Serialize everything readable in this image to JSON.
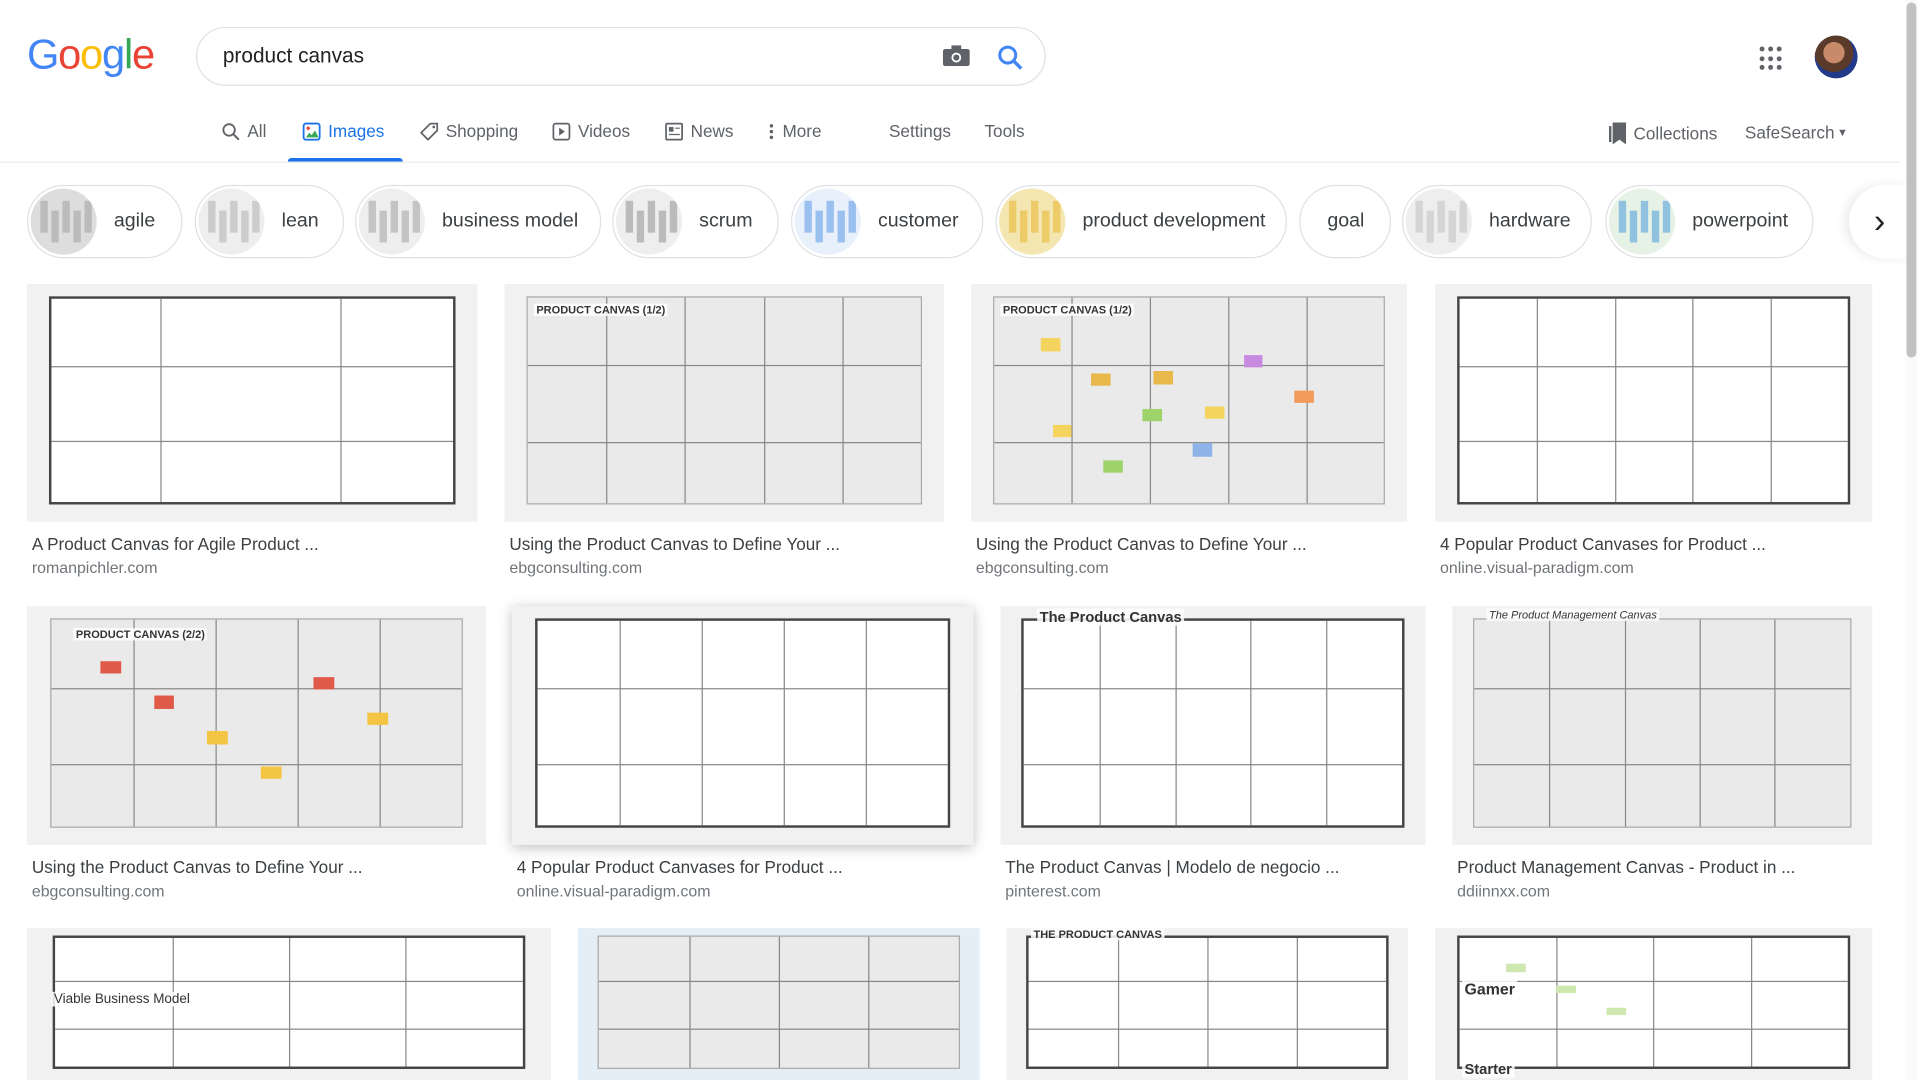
{
  "logo": {
    "letters": [
      "G",
      "o",
      "o",
      "g",
      "l",
      "e"
    ],
    "colors": [
      "#4285f4",
      "#ea4335",
      "#fbbc05",
      "#4285f4",
      "#34a853",
      "#ea4335"
    ]
  },
  "search": {
    "query": "product canvas"
  },
  "tabs": [
    {
      "label": "All",
      "icon": "search-icon"
    },
    {
      "label": "Images",
      "icon": "image-icon",
      "active": true
    },
    {
      "label": "Shopping",
      "icon": "tag-icon"
    },
    {
      "label": "Videos",
      "icon": "play-icon"
    },
    {
      "label": "News",
      "icon": "news-icon"
    },
    {
      "label": "More",
      "icon": "more-vert-icon"
    },
    {
      "label": "Settings"
    },
    {
      "label": "Tools"
    }
  ],
  "right_tools": {
    "collections": "Collections",
    "safesearch": "SafeSearch"
  },
  "chips": [
    "agile",
    "lean",
    "business model",
    "scrum",
    "customer",
    "product development",
    "goal",
    "hardware",
    "powerpoint"
  ],
  "results": [
    {
      "title": "A Product Canvas for Agile Product ...",
      "source": "romanpichler.com"
    },
    {
      "title": "Using the Product Canvas to Define Your ...",
      "source": "ebgconsulting.com"
    },
    {
      "title": "Using the Product Canvas to Define Your ...",
      "source": "ebgconsulting.com"
    },
    {
      "title": "4 Popular Product Canvases for Product ...",
      "source": "online.visual-paradigm.com"
    },
    {
      "title": "Using the Product Canvas to Define Your ...",
      "source": "ebgconsulting.com"
    },
    {
      "title": "4 Popular Product Canvases for Product ...",
      "source": "online.visual-paradigm.com"
    },
    {
      "title": "The Product Canvas | Modelo de negocio ...",
      "source": "pinterest.com"
    },
    {
      "title": "Product Management Canvas - Product in ...",
      "source": "ddiinnxx.com"
    }
  ],
  "thumb_text": {
    "r1c2": "PRODUCT CANVAS (1/2)",
    "r1c3": "PRODUCT CANVAS (1/2)",
    "r2c1": "PRODUCT CANVAS (2/2)",
    "r2c3": "The Product Canvas",
    "r2c4": "The Product Management Canvas",
    "r3c3": "THE PRODUCT CANVAS",
    "r3c1": "Viable Business Model",
    "r3c4a": "Gamer",
    "r3c4b": "Starter"
  }
}
